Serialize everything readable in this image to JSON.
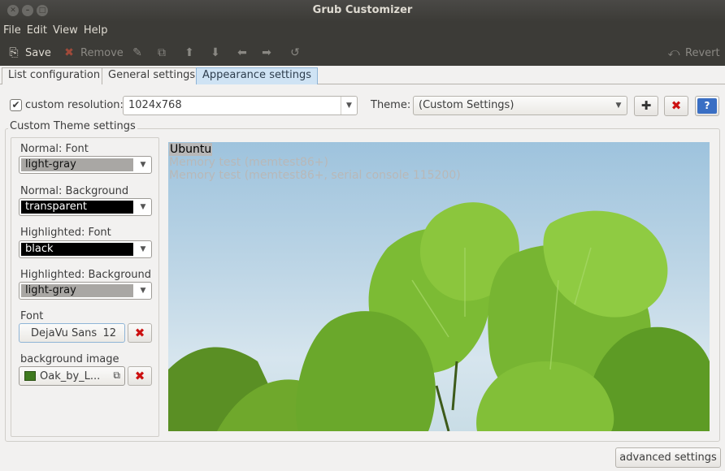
{
  "window": {
    "title": "Grub Customizer"
  },
  "menu": [
    "File",
    "Edit",
    "View",
    "Help"
  ],
  "toolbar": {
    "save": "Save",
    "remove": "Remove",
    "revert": "Revert"
  },
  "tabs": [
    "List configuration",
    "General settings",
    "Appearance settings"
  ],
  "resolution": {
    "checked": true,
    "label": "custom resolution:",
    "value": "1024x768"
  },
  "theme": {
    "label": "Theme:",
    "value": "(Custom Settings)"
  },
  "custom_theme": {
    "title": "Custom Theme settings",
    "normal_font_label": "Normal: Font",
    "normal_font_value": "light-gray",
    "normal_bg_label": "Normal: Background",
    "normal_bg_value": "transparent",
    "highlight_font_label": "Highlighted: Font",
    "highlight_font_value": "black",
    "highlight_bg_label": "Highlighted: Background",
    "highlight_bg_value": "light-gray",
    "font_label": "Font",
    "font_name": "DejaVu Sans",
    "font_size": "12",
    "bg_image_label": "background image",
    "bg_image_value": "Oak_by_L..."
  },
  "preview": {
    "entries": [
      "Ubuntu",
      "Memory test (memtest86+)",
      "Memory test (memtest86+, serial console 115200)"
    ]
  },
  "advanced_button": "advanced settings",
  "colors": {
    "light_gray": "#a9a7a4",
    "black": "#000000",
    "titlebar": "#3c3b37",
    "tab_active": "#cfe3f4"
  }
}
